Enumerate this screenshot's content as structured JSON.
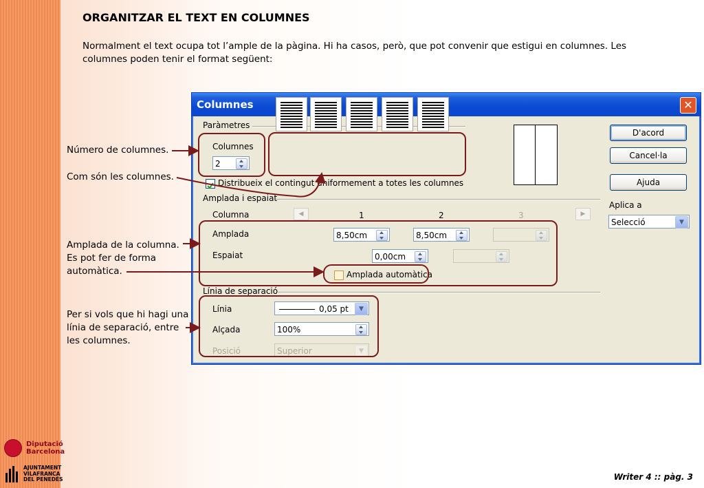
{
  "page": {
    "title": "ORGANITZAR EL TEXT EN COLUMNES",
    "intro": "Normalment el text ocupa tot l’ample de la pàgina. Hi ha casos, però, que pot convenir que estigui en columnes. Les columnes poden tenir el format següent:",
    "footer": "Writer 4 :: pàg. 3"
  },
  "notes": {
    "num_columns": "Número de columnes.",
    "column_type": "Com són les columnes.",
    "width_line1": "Amplada de la columna.",
    "width_line2": "Es pot fer de forma",
    "width_line3": "automàtica.",
    "sep_line1": "Per si vols que hi hagi una",
    "sep_line2": "línia de separació, entre",
    "sep_line3": "les columnes."
  },
  "logos": {
    "diputacio_line1": "Diputació",
    "diputacio_line2": "Barcelona",
    "ajuntament_line1": "AJUNTAMENT",
    "ajuntament_line2": "VILAFRANCA",
    "ajuntament_line3": "DEL PENEDÈS"
  },
  "dialog": {
    "title": "Columnes",
    "close_label": "✕",
    "params_section": "Paràmetres",
    "columns_label": "Columnes",
    "columns_value": "2",
    "distribute_label": "Distribueix el contingut uniformement a totes les columnes",
    "distribute_checked": true,
    "width_spacing_section": "Amplada i espaiat",
    "column_label": "Columna",
    "col1": "1",
    "col2": "2",
    "col3": "3",
    "width_label": "Amplada",
    "width1": "8,50cm",
    "width2": "8,50cm",
    "width3": "",
    "spacing_label": "Espaiat",
    "spacing1": "0,00cm",
    "spacing2": "",
    "auto_width_label": "Amplada automàtica",
    "auto_width_checked": false,
    "separator_section": "Línia de separació",
    "line_label": "Línia",
    "line_value": "0,05 pt",
    "height_label": "Alçada",
    "height_value": "100%",
    "position_label": "Posició",
    "position_value": "Superior",
    "ok_button": "D'acord",
    "cancel_button": "Cancel·la",
    "help_button": "Ajuda",
    "apply_label": "Aplica a",
    "apply_value": "Selecció"
  },
  "colors": {
    "stripe": "#f08a50",
    "annotation": "#7a1b1b",
    "titlebar": "#0a4ad3"
  }
}
